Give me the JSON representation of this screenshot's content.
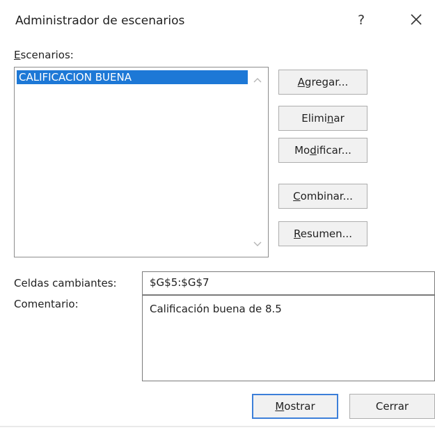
{
  "window": {
    "title": "Administrador de escenarios",
    "help_label": "?",
    "close_icon": "close-icon"
  },
  "scenarios": {
    "label_first": "E",
    "label_rest": "scenarios:",
    "items": [
      {
        "label": "CALIFICACION BUENA",
        "selected": true
      }
    ],
    "selection_color": "#1d78d6"
  },
  "buttons": {
    "agregar": {
      "mnemonic": "A",
      "rest": "gregar..."
    },
    "eliminar": {
      "before": "Elimi",
      "mnemonic": "n",
      "after": "ar"
    },
    "modificar": {
      "before": "Mo",
      "mnemonic": "d",
      "after": "ificar..."
    },
    "combinar": {
      "mnemonic": "C",
      "rest": "ombinar..."
    },
    "resumen": {
      "mnemonic": "R",
      "rest": "esumen..."
    }
  },
  "fields": {
    "changing_cells_label": "Celdas cambiantes:",
    "changing_cells_value": "$G$5:$G$7",
    "comment_label": "Comentario:",
    "comment_value": "Calificación buena de 8.5"
  },
  "footer": {
    "mostrar": {
      "mnemonic": "M",
      "rest": "ostrar"
    },
    "cerrar_label": "Cerrar",
    "primary_border_color": "#3c7fd9"
  }
}
